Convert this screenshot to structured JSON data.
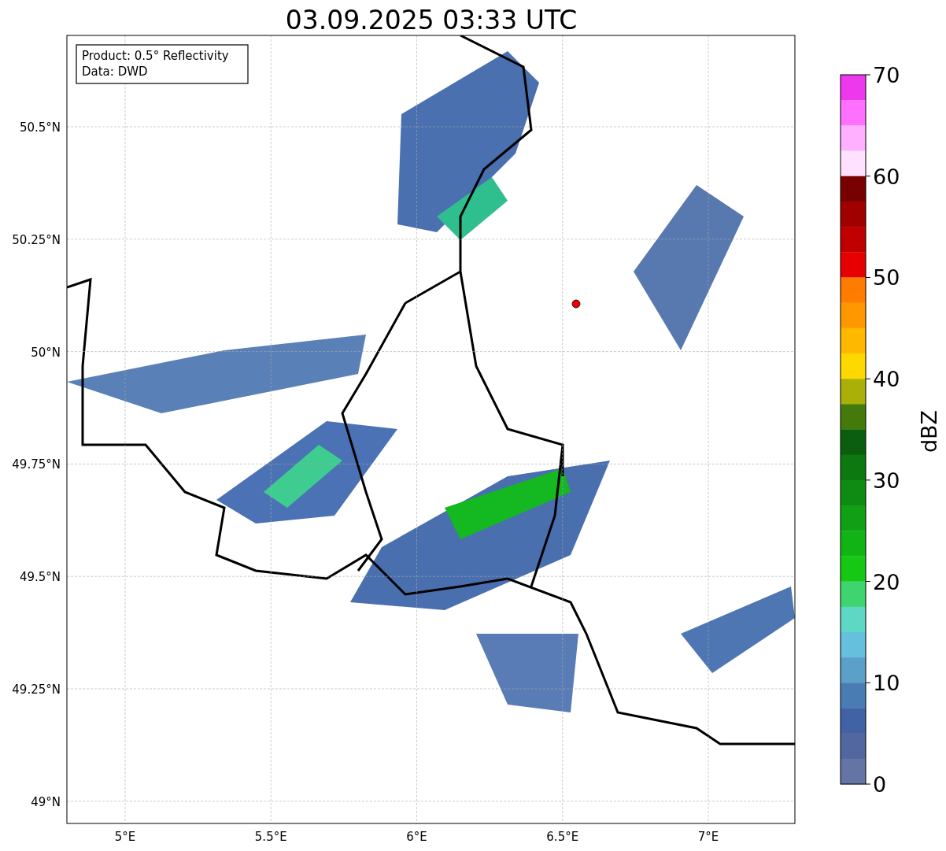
{
  "title": "03.09.2025 03:33 UTC",
  "info_box": [
    "Product: 0.5° Reflectivity",
    "Data: DWD"
  ],
  "x_ticks": [
    "5°E",
    "5.5°E",
    "6°E",
    "6.5°E",
    "7°E"
  ],
  "y_ticks": [
    "50.5°N",
    "50.25°N",
    "50°N",
    "49.75°N",
    "49.5°N",
    "49.25°N",
    "49°N"
  ],
  "colorbar": {
    "label": "dBZ",
    "ticks": [
      "70",
      "60",
      "50",
      "40",
      "30",
      "20",
      "10",
      "0"
    ],
    "segments": [
      {
        "color": "#ee38ee"
      },
      {
        "color": "#ff70ff"
      },
      {
        "color": "#ffb0ff"
      },
      {
        "color": "#ffe0ff"
      },
      {
        "color": "#780000"
      },
      {
        "color": "#a00000"
      },
      {
        "color": "#c00000"
      },
      {
        "color": "#e60000"
      },
      {
        "color": "#ff7c00"
      },
      {
        "color": "#ff9800"
      },
      {
        "color": "#ffb800"
      },
      {
        "color": "#ffd800"
      },
      {
        "color": "#aab008"
      },
      {
        "color": "#447a0c"
      },
      {
        "color": "#0a5e0e"
      },
      {
        "color": "#0c7810"
      },
      {
        "color": "#0e8c12"
      },
      {
        "color": "#10a014"
      },
      {
        "color": "#10b414"
      },
      {
        "color": "#14c814"
      },
      {
        "color": "#3ed46e"
      },
      {
        "color": "#5ed8c4"
      },
      {
        "color": "#64c0dc"
      },
      {
        "color": "#5aa0c8"
      },
      {
        "color": "#4a7cb4"
      },
      {
        "color": "#4262a6"
      },
      {
        "color": "#5266a0"
      },
      {
        "color": "#6474a4"
      }
    ]
  }
}
